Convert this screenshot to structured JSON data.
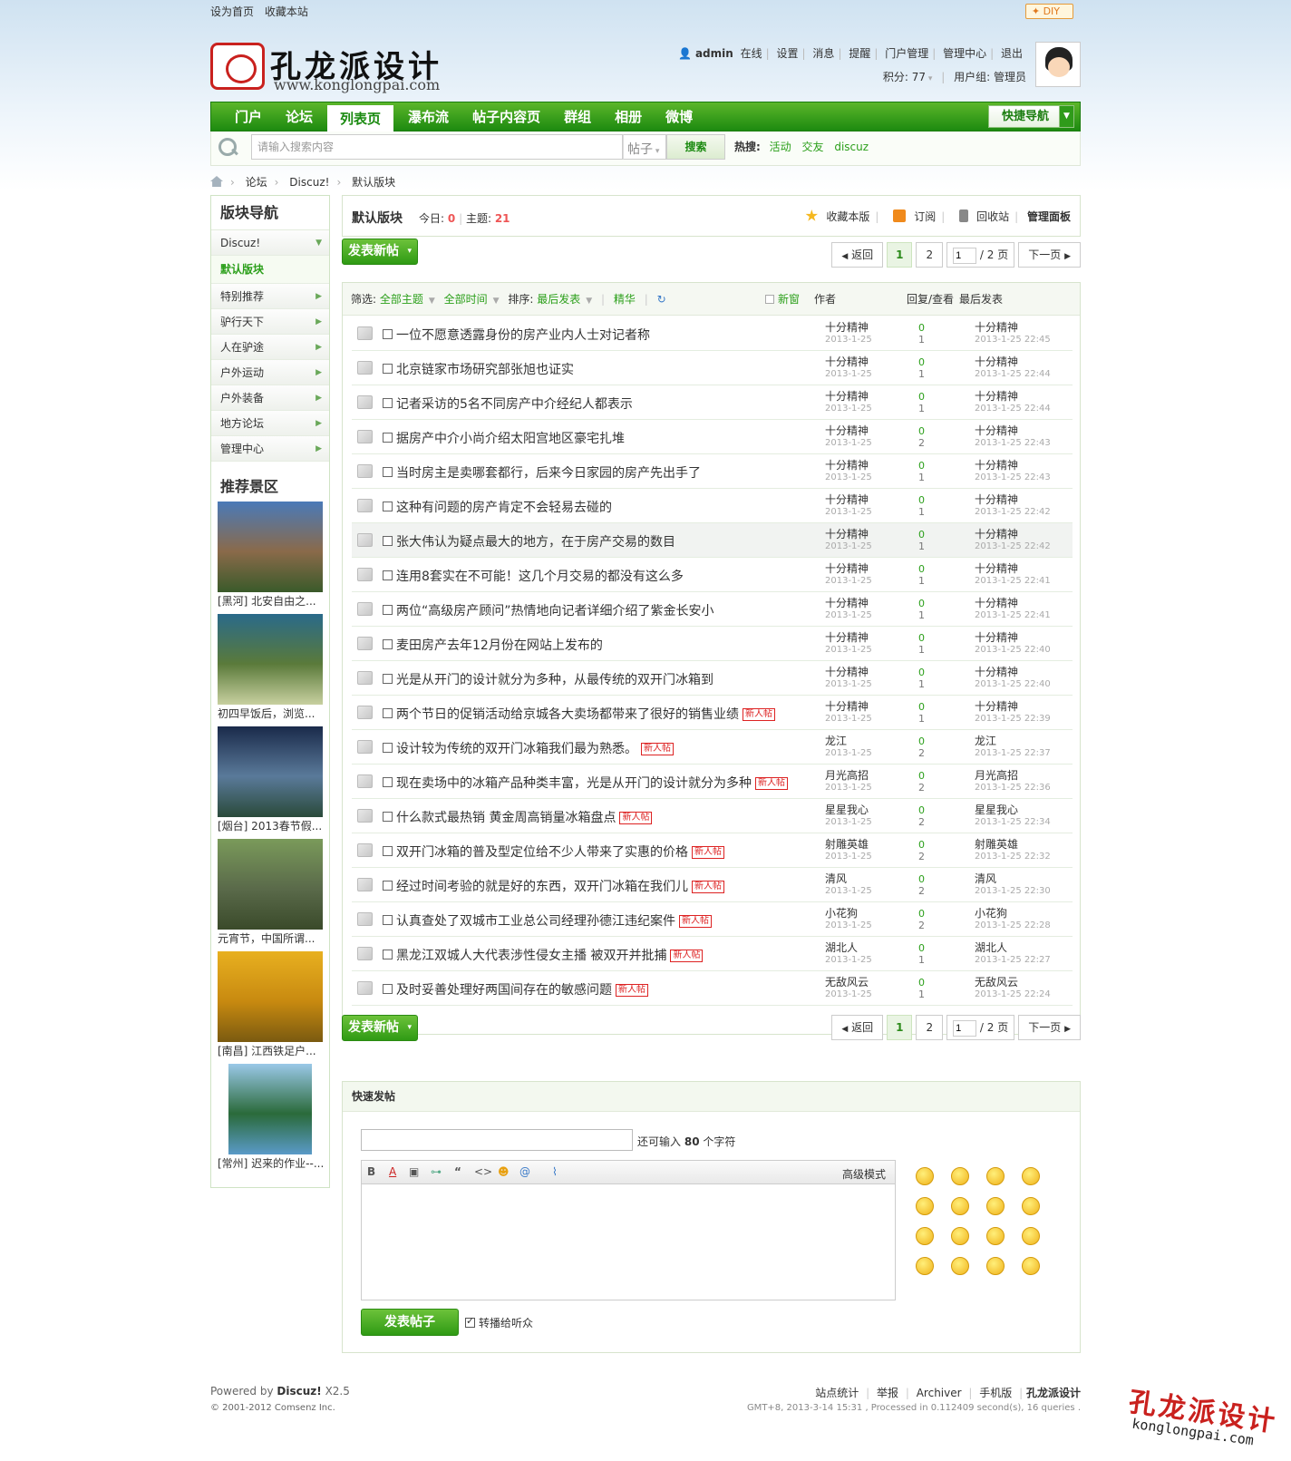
{
  "topbar": {
    "sethome": "设为首页",
    "favorite": "收藏本站",
    "diy": "DIY"
  },
  "header": {
    "logo_text": "孔龙派设计",
    "logo_url": "www.konglongpai.com",
    "user": {
      "name": "admin",
      "status": "在线",
      "links": [
        "设置",
        "消息",
        "提醒",
        "门户管理",
        "管理中心",
        "退出"
      ],
      "points_label": "积分: 77",
      "group_label": "用户组: 管理员"
    }
  },
  "nav": {
    "items": [
      "门户",
      "论坛",
      "列表页",
      "瀑布流",
      "帖子内容页",
      "群组",
      "相册",
      "微博"
    ],
    "active": "列表页",
    "quick": "快捷导航"
  },
  "search": {
    "placeholder": "请输入搜索内容",
    "type": "帖子",
    "button": "搜索",
    "hot_label": "热搜:",
    "hot": [
      "活动",
      "交友",
      "discuz"
    ]
  },
  "breadcrumb": [
    "论坛",
    "Discuz!",
    "默认版块"
  ],
  "sidebar": {
    "title": "版块导航",
    "items": [
      {
        "label": "Discuz!"
      },
      {
        "label": "默认版块"
      },
      {
        "label": "特别推荐"
      },
      {
        "label": "驴行天下"
      },
      {
        "label": "人在驴途"
      },
      {
        "label": "户外运动"
      },
      {
        "label": "户外装备"
      },
      {
        "label": "地方论坛"
      },
      {
        "label": "管理中心"
      }
    ],
    "rec_title": "推荐景区",
    "pics": [
      {
        "caption": "[黑河] 北安自由之...",
        "colors": [
          "#4a7ab8",
          "#8a6a4a",
          "#3a5a2a"
        ]
      },
      {
        "caption": "初四早饭后，浏览...",
        "colors": [
          "#2a6a8a",
          "#5a7a3a",
          "#c8d0a0"
        ]
      },
      {
        "caption": "[烟台] 2013春节假...",
        "colors": [
          "#1a2a4a",
          "#5a7a9a",
          "#2a4a3a"
        ]
      },
      {
        "caption": "元宵节，中国所谓...",
        "colors": [
          "#7a9a5a",
          "#5a6a4a",
          "#3a4a2a"
        ]
      },
      {
        "caption": "[南昌] 江西铁足户...",
        "colors": [
          "#e8b020",
          "#c88a10",
          "#7a5a10"
        ]
      },
      {
        "caption": "[常州] 迟来的作业--...",
        "colors": [
          "#9ac8e8",
          "#2a6a3a",
          "#5a9ac8"
        ]
      }
    ]
  },
  "forum": {
    "name": "默认版块",
    "today_label": "今日:",
    "today": "0",
    "threads_label": "主题:",
    "threads": "21",
    "actions": {
      "fav": "收藏本版",
      "rss": "订阅",
      "recycle": "回收站",
      "manage": "管理面板"
    }
  },
  "buttons": {
    "newthread": "发表新帖"
  },
  "pager": {
    "back": "返回",
    "pages": [
      "1",
      "2"
    ],
    "input": "1",
    "total": "/ 2 页",
    "next": "下一页"
  },
  "filter": {
    "label": "筛选:",
    "all": "全部主题",
    "time": "全部时间",
    "sort": "排序:",
    "sortby": "最后发表",
    "digest": "精华",
    "newwin": "新窗",
    "author": "作者",
    "replies": "回复/查看",
    "lastpost": "最后发表"
  },
  "threads": [
    {
      "title": "一位不愿意透露身份的房产业内人士对记者称",
      "author": "十分精神",
      "date": "2013-1-25",
      "replies": "0",
      "views": "1",
      "last_author": "十分精神",
      "last_time": "2013-1-25 22:45",
      "new": false
    },
    {
      "title": "北京链家市场研究部张旭也证实",
      "author": "十分精神",
      "date": "2013-1-25",
      "replies": "0",
      "views": "1",
      "last_author": "十分精神",
      "last_time": "2013-1-25 22:44",
      "new": false
    },
    {
      "title": "记者采访的5名不同房产中介经纪人都表示",
      "author": "十分精神",
      "date": "2013-1-25",
      "replies": "0",
      "views": "1",
      "last_author": "十分精神",
      "last_time": "2013-1-25 22:44",
      "new": false
    },
    {
      "title": "据房产中介小尚介绍太阳宫地区豪宅扎堆",
      "author": "十分精神",
      "date": "2013-1-25",
      "replies": "0",
      "views": "2",
      "last_author": "十分精神",
      "last_time": "2013-1-25 22:43",
      "new": false
    },
    {
      "title": "当时房主是卖哪套都行，后来今日家园的房产先出手了",
      "author": "十分精神",
      "date": "2013-1-25",
      "replies": "0",
      "views": "1",
      "last_author": "十分精神",
      "last_time": "2013-1-25 22:43",
      "new": false
    },
    {
      "title": "这种有问题的房产肯定不会轻易去碰的",
      "author": "十分精神",
      "date": "2013-1-25",
      "replies": "0",
      "views": "1",
      "last_author": "十分精神",
      "last_time": "2013-1-25 22:42",
      "new": false
    },
    {
      "title": "张大伟认为疑点最大的地方，在于房产交易的数目",
      "author": "十分精神",
      "date": "2013-1-25",
      "replies": "0",
      "views": "1",
      "last_author": "十分精神",
      "last_time": "2013-1-25 22:42",
      "new": false
    },
    {
      "title": "连用8套实在不可能！这几个月交易的都没有这么多",
      "author": "十分精神",
      "date": "2013-1-25",
      "replies": "0",
      "views": "1",
      "last_author": "十分精神",
      "last_time": "2013-1-25 22:41",
      "new": false
    },
    {
      "title": "两位“高级房产顾问”热情地向记者详细介绍了紫金长安小",
      "author": "十分精神",
      "date": "2013-1-25",
      "replies": "0",
      "views": "1",
      "last_author": "十分精神",
      "last_time": "2013-1-25 22:41",
      "new": false
    },
    {
      "title": "麦田房产去年12月份在网站上发布的",
      "author": "十分精神",
      "date": "2013-1-25",
      "replies": "0",
      "views": "1",
      "last_author": "十分精神",
      "last_time": "2013-1-25 22:40",
      "new": false
    },
    {
      "title": "光是从开门的设计就分为多种，从最传统的双开门冰箱到",
      "author": "十分精神",
      "date": "2013-1-25",
      "replies": "0",
      "views": "1",
      "last_author": "十分精神",
      "last_time": "2013-1-25 22:40",
      "new": false
    },
    {
      "title": "两个节日的促销活动给京城各大卖场都带来了很好的销售业绩",
      "author": "十分精神",
      "date": "2013-1-25",
      "replies": "0",
      "views": "1",
      "last_author": "十分精神",
      "last_time": "2013-1-25 22:39",
      "new": true
    },
    {
      "title": "设计较为传统的双开门冰箱我们最为熟悉。",
      "author": "龙江",
      "date": "2013-1-25",
      "replies": "0",
      "views": "2",
      "last_author": "龙江",
      "last_time": "2013-1-25 22:37",
      "new": true
    },
    {
      "title": "现在卖场中的冰箱产品种类丰富，光是从开门的设计就分为多种",
      "author": "月光高招",
      "date": "2013-1-25",
      "replies": "0",
      "views": "2",
      "last_author": "月光高招",
      "last_time": "2013-1-25 22:36",
      "new": true
    },
    {
      "title": "什么款式最热销 黄金周高销量冰箱盘点",
      "author": "星星我心",
      "date": "2013-1-25",
      "replies": "0",
      "views": "2",
      "last_author": "星星我心",
      "last_time": "2013-1-25 22:34",
      "new": true
    },
    {
      "title": "双开门冰箱的普及型定位给不少人带来了实惠的价格",
      "author": "射雕英雄",
      "date": "2013-1-25",
      "replies": "0",
      "views": "2",
      "last_author": "射雕英雄",
      "last_time": "2013-1-25 22:32",
      "new": true
    },
    {
      "title": "经过时间考验的就是好的东西，双开门冰箱在我们儿",
      "author": "清风",
      "date": "2013-1-25",
      "replies": "0",
      "views": "2",
      "last_author": "清风",
      "last_time": "2013-1-25 22:30",
      "new": true
    },
    {
      "title": "认真查处了双城市工业总公司经理孙德江违纪案件",
      "author": "小花狗",
      "date": "2013-1-25",
      "replies": "0",
      "views": "2",
      "last_author": "小花狗",
      "last_time": "2013-1-25 22:28",
      "new": true
    },
    {
      "title": "黑龙江双城人大代表涉性侵女主播 被双开并批捕",
      "author": "湖北人",
      "date": "2013-1-25",
      "replies": "0",
      "views": "1",
      "last_author": "湖北人",
      "last_time": "2013-1-25 22:27",
      "new": true
    },
    {
      "title": "及时妥善处理好两国间存在的敏感问题",
      "author": "无敌风云",
      "date": "2013-1-25",
      "replies": "0",
      "views": "1",
      "last_author": "无敌风云",
      "last_time": "2013-1-25 22:24",
      "new": true
    }
  ],
  "new_badge": "新人帖",
  "fastpost": {
    "title": "快速发帖",
    "remain_prefix": "还可输入",
    "remain_num": "80",
    "remain_suffix": "个字符",
    "advanced": "高级模式",
    "submit": "发表帖子",
    "broadcast": "转播给听众"
  },
  "footer": {
    "powered_prefix": "Powered by",
    "powered": "Discuz!",
    "version": "X2.5",
    "copyright": "© 2001-2012 Comsenz Inc.",
    "links": [
      "站点统计",
      "举报",
      "Archiver",
      "手机版",
      "孔龙派设计"
    ],
    "gmt": "GMT+8, 2013-3-14 15:31 , Processed in 0.112409 second(s), 16 queries ."
  },
  "watermark": {
    "text": "孔龙派设计",
    "url": "konglongpai.com"
  }
}
